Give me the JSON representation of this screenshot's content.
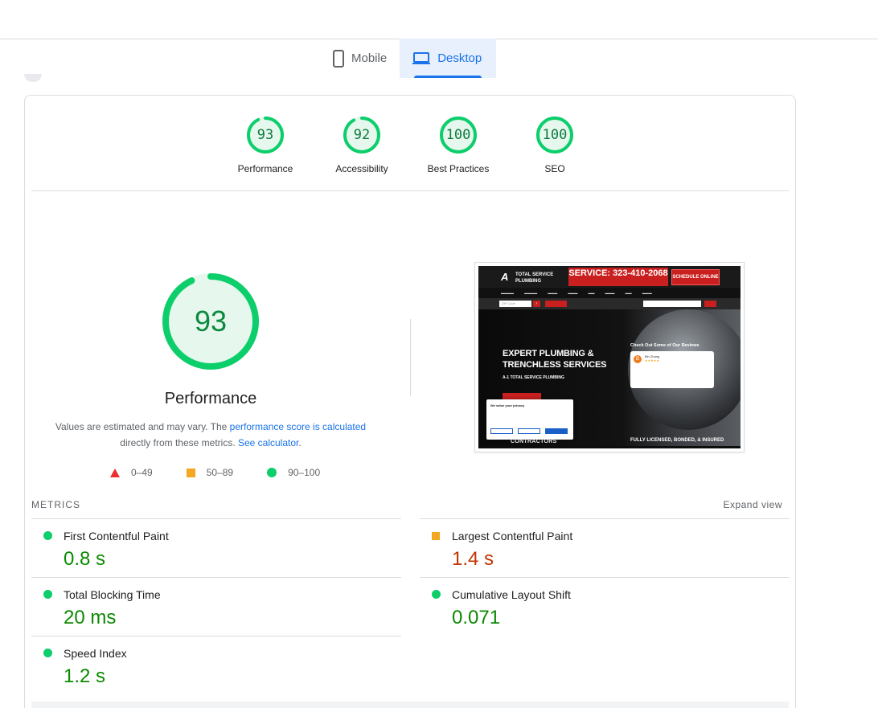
{
  "tabs": [
    {
      "label": "Mobile",
      "icon": "phone-icon",
      "active": false
    },
    {
      "label": "Desktop",
      "icon": "laptop-icon",
      "active": true
    }
  ],
  "scores": [
    {
      "value": "93",
      "label": "Performance",
      "fraction": 0.93
    },
    {
      "value": "92",
      "label": "Accessibility",
      "fraction": 0.92
    },
    {
      "value": "100",
      "label": "Best Practices",
      "fraction": 1.0
    },
    {
      "value": "100",
      "label": "SEO",
      "fraction": 1.0
    }
  ],
  "performance": {
    "score": "93",
    "fraction": 0.93,
    "title": "Performance",
    "note_prefix": "Values are estimated and may vary. The ",
    "note_link1": "performance score is calculated",
    "note_middle": " directly from these metrics. ",
    "note_link2": "See calculator",
    "note_suffix": "."
  },
  "legend": [
    {
      "range": "0–49",
      "shape": "triangle",
      "color": "#eb2f2f"
    },
    {
      "range": "50–89",
      "shape": "square",
      "color": "#f5a623"
    },
    {
      "range": "90–100",
      "shape": "circle",
      "color": "#0cce6b"
    }
  ],
  "thumbnail": {
    "phone_text": "SERVICE: 323-410-2068",
    "schedule": "SCHEDULE ONLINE",
    "logo_mark": "A",
    "logo_text": "TOTAL SERVICE PLUMBING",
    "zip_placeholder": "ZIP Code",
    "hero_title_line1": "EXPERT PLUMBING &",
    "hero_title_line2": "TRENCHLESS SERVICES",
    "hero_sub": "A-1 TOTAL SERVICE PLUMBING",
    "reviews_heading": "Check Out Some of Our Reviews",
    "reviewer": "Bin Zhang",
    "badge": "FULLY LICENSED, BONDED, & INSURED",
    "contractors": "CONTRACTORS",
    "cookie_title": "We value your privacy"
  },
  "metrics": {
    "heading": "METRICS",
    "expand": "Expand view",
    "items": [
      {
        "name": "First Contentful Paint",
        "value": "0.8 s",
        "status": "good"
      },
      {
        "name": "Largest Contentful Paint",
        "value": "1.4 s",
        "status": "average"
      },
      {
        "name": "Total Blocking Time",
        "value": "20 ms",
        "status": "good"
      },
      {
        "name": "Cumulative Layout Shift",
        "value": "0.071",
        "status": "good"
      },
      {
        "name": "Speed Index",
        "value": "1.2 s",
        "status": "good"
      }
    ]
  },
  "colors": {
    "pass": "#0cce6b",
    "pass_text": "#0b8a00",
    "average": "#f5a623",
    "average_text": "#c33300",
    "fail": "#eb2f2f",
    "accent": "#1a73e8"
  }
}
